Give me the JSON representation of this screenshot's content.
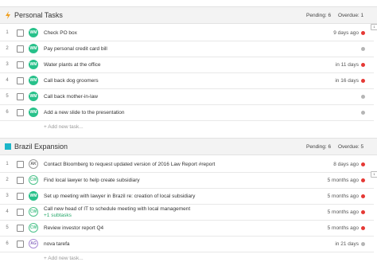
{
  "colors": {
    "personal_icon": "#f0a020",
    "brazil_icon": "#1bb6c9",
    "overdue_dot": "#e53935",
    "neutral_dot": "#b5b5b5"
  },
  "sections": {
    "personal": {
      "title": "Personal Tasks",
      "icon": "lightning-icon",
      "pending": "Pending: 6",
      "overdue": "Overdue: 1",
      "add_task": "+ Add new task...",
      "tasks": [
        {
          "num": "1",
          "avatar": "WM",
          "name": "Check PO box",
          "due": "9 days ago",
          "status": "red"
        },
        {
          "num": "2",
          "avatar": "WM",
          "name": "Pay personal credit card bill",
          "due": "",
          "status": "grey"
        },
        {
          "num": "3",
          "avatar": "WM",
          "name": "Water plants at the office",
          "due": "in 11 days",
          "status": "red"
        },
        {
          "num": "4",
          "avatar": "WM",
          "name": "Call back dog groomers",
          "due": "in 16 days",
          "status": "red"
        },
        {
          "num": "5",
          "avatar": "WM",
          "name": "Call back mother-in-law",
          "due": "",
          "status": "grey"
        },
        {
          "num": "6",
          "avatar": "WM",
          "name": "Add a new slide to the presentation",
          "due": "",
          "status": "grey"
        }
      ]
    },
    "brazil": {
      "title": "Brazil Expansion",
      "icon": "square-icon",
      "pending": "Pending: 6",
      "overdue": "Overdue: 5",
      "add_task": "+ Add new task...",
      "tasks": [
        {
          "num": "1",
          "avatar": "AK",
          "name": "Contact Bloomberg to request updated version of 2016 Law Report #report",
          "due": "8 days ago",
          "status": "red"
        },
        {
          "num": "2",
          "avatar": "CW",
          "name": "Find local lawyer to help create subsidiary",
          "due": "5 months ago",
          "status": "red"
        },
        {
          "num": "3",
          "avatar": "WM",
          "name": "Set up meeting with lawyer in Brazil re: creation of local subsidiary",
          "due": "5 months ago",
          "status": "red"
        },
        {
          "num": "4",
          "avatar": "CW",
          "name": "Call new head of IT to schedule meeting with local management",
          "subtasks": "+1 subtasks",
          "due": "5 months ago",
          "status": "red"
        },
        {
          "num": "5",
          "avatar": "CW",
          "name": "Review investor report Q4",
          "due": "5 months ago",
          "status": "red"
        },
        {
          "num": "6",
          "avatar": "AG",
          "name": "nova tarefa",
          "due": "in 21 days",
          "status": "grey"
        }
      ]
    }
  },
  "comment_badges": {
    "personal_row1": "1",
    "brazil_row2": "1"
  }
}
